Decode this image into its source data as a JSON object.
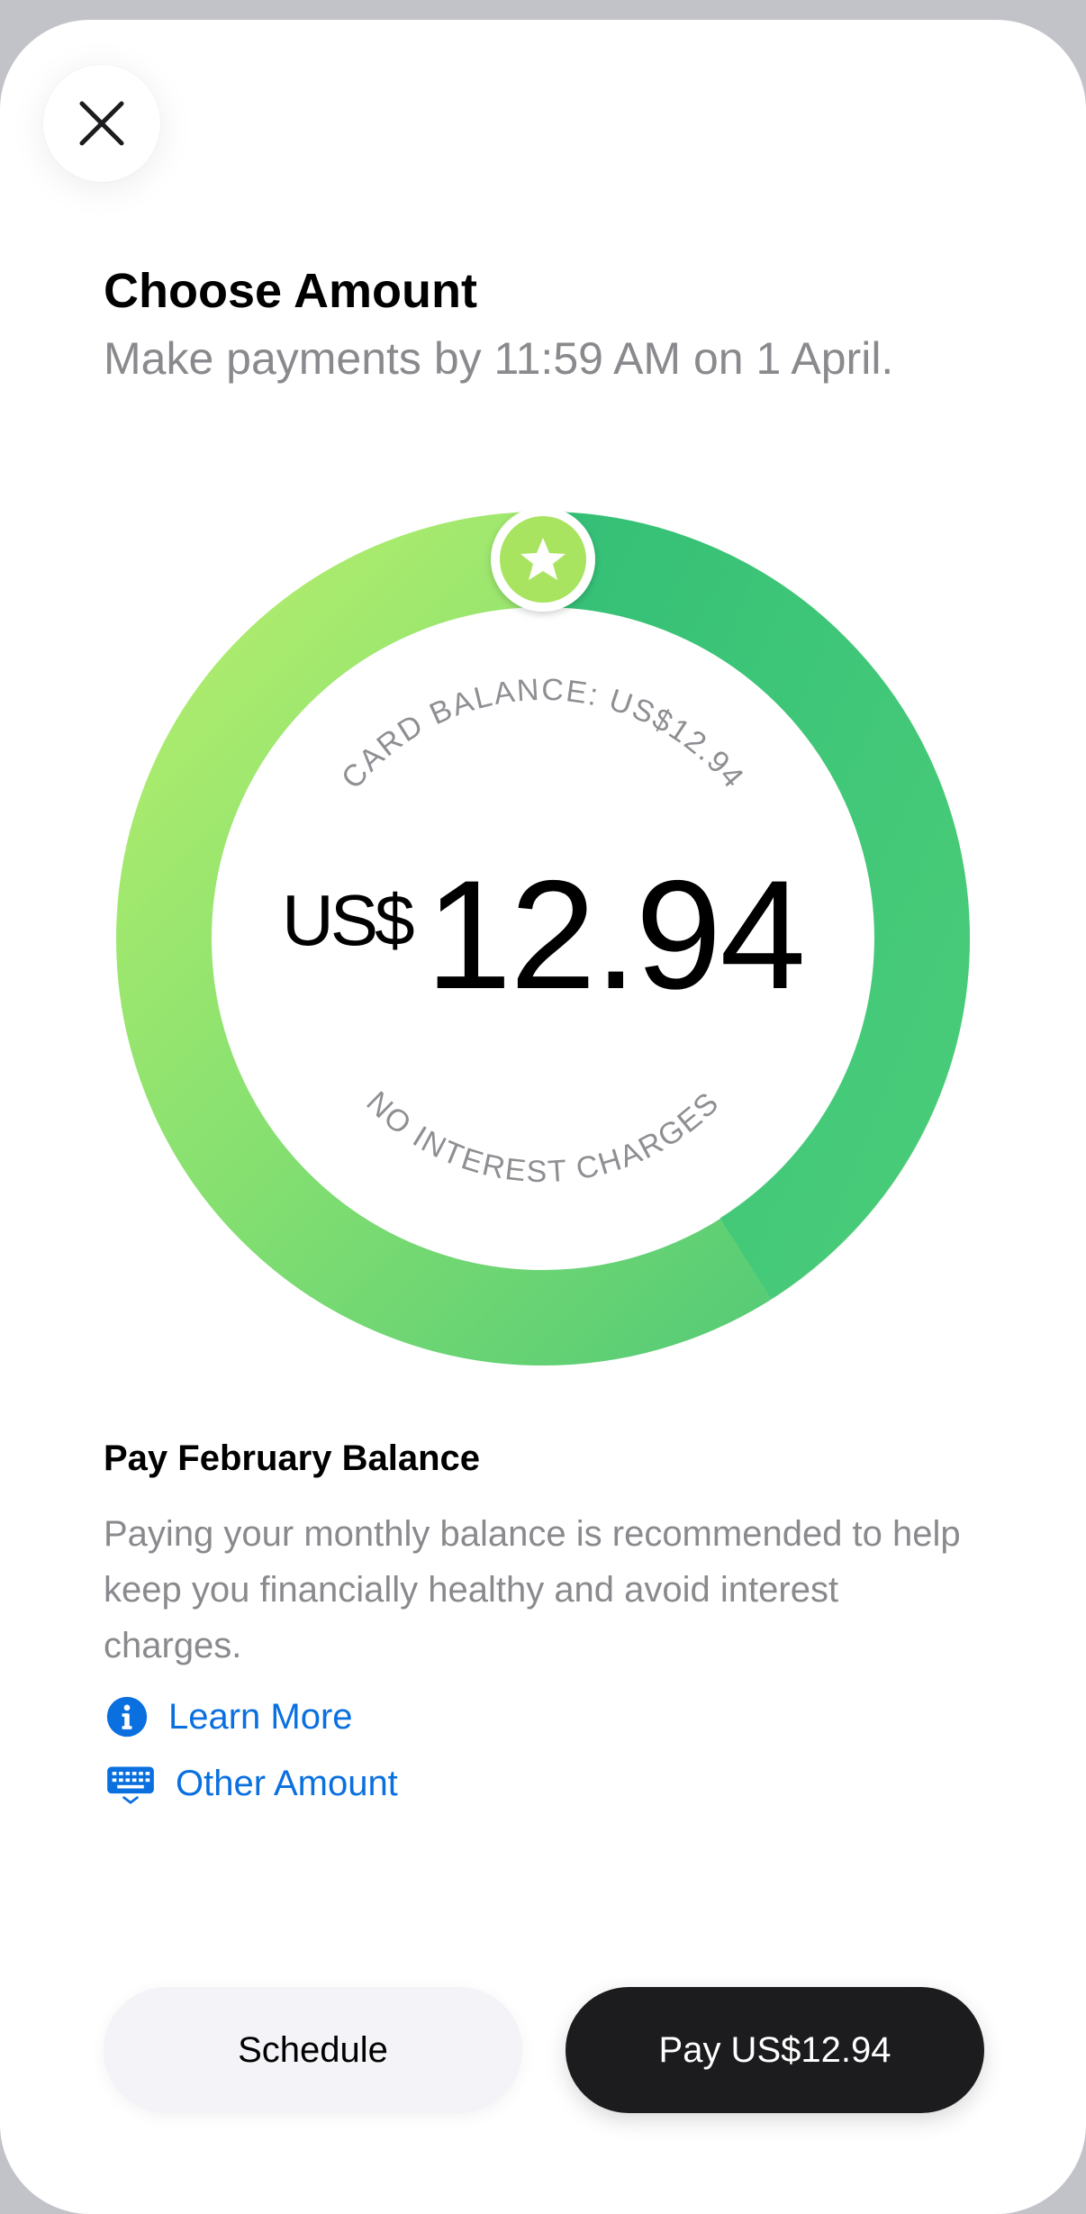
{
  "header": {
    "title": "Choose Amount",
    "subtitle": "Make payments by 11:59 AM on 1 April."
  },
  "dial": {
    "top_label": "CARD BALANCE: US$12.94",
    "bottom_label": "NO INTEREST CHARGES",
    "currency": "US$",
    "amount": "12.94",
    "handle_icon": "star-icon",
    "colors": {
      "light_green": "#b5ee6d",
      "dark_green": "#2cc278",
      "mid_green": "#5fd27a"
    }
  },
  "recommendation": {
    "title": "Pay February Balance",
    "body": "Paying your monthly balance is recommended to help keep you financially healthy and avoid interest charges."
  },
  "links": {
    "learn_more": "Learn More",
    "other_amount": "Other Amount",
    "color": "#0a70e0"
  },
  "actions": {
    "schedule_label": "Schedule",
    "pay_label": "Pay US$12.94"
  }
}
